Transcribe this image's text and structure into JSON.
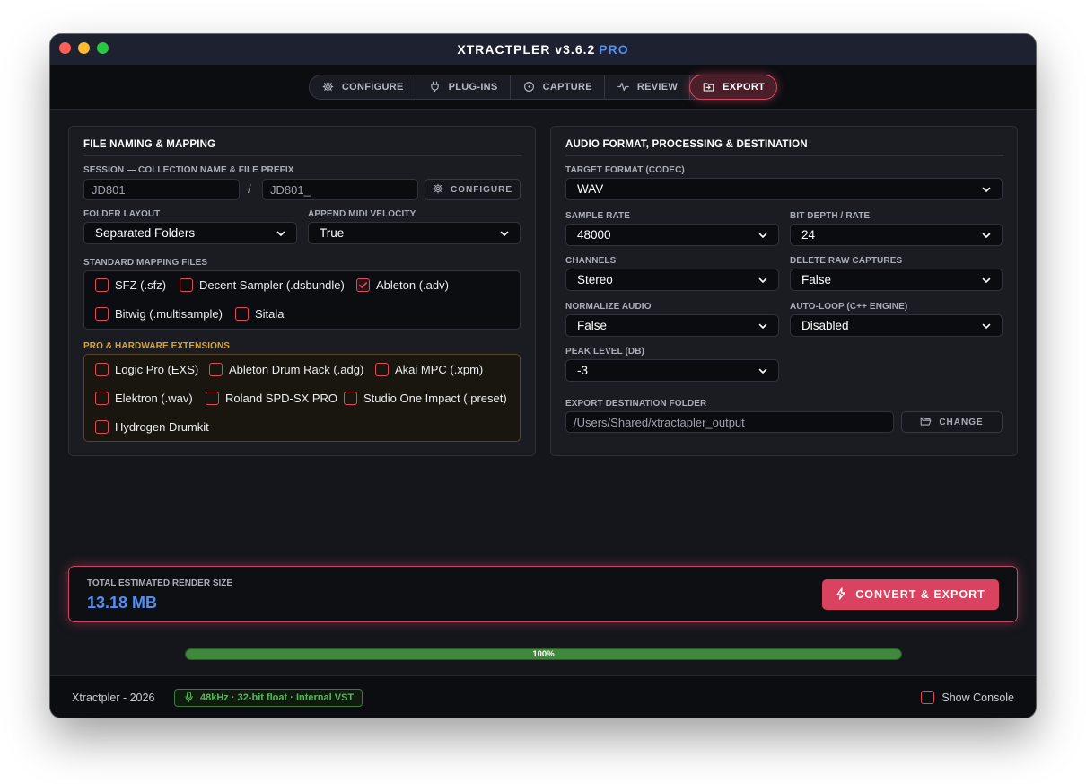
{
  "window": {
    "title": "XTRACTPLER v3.6.2",
    "badge": "PRO"
  },
  "tabs": [
    {
      "label": "CONFIGURE",
      "icon": "gear-icon"
    },
    {
      "label": "PLUG-INS",
      "icon": "plug-icon"
    },
    {
      "label": "CAPTURE",
      "icon": "record-icon"
    },
    {
      "label": "REVIEW",
      "icon": "waveform-icon"
    },
    {
      "label": "EXPORT",
      "icon": "export-folder-icon",
      "active": true
    }
  ],
  "left_panel": {
    "title": "FILE NAMING & MAPPING",
    "session_label": "SESSION — COLLECTION NAME & FILE PREFIX",
    "collection_name": "JD801",
    "separator": "/",
    "file_prefix": "JD801_",
    "configure_button": "CONFIGURE",
    "folder_layout_label": "FOLDER LAYOUT",
    "folder_layout_value": "Separated Folders",
    "append_velocity_label": "APPEND MIDI VELOCITY",
    "append_velocity_value": "True",
    "standard_label": "STANDARD MAPPING FILES",
    "standard_files": [
      {
        "label": "SFZ (.sfz)",
        "checked": false
      },
      {
        "label": "Decent Sampler (.dsbundle)",
        "checked": false
      },
      {
        "label": "Ableton (.adv)",
        "checked": true
      },
      {
        "label": "Bitwig (.multisample)",
        "checked": false
      },
      {
        "label": "Sitala",
        "checked": false
      }
    ],
    "pro_label": "PRO & HARDWARE EXTENSIONS",
    "pro_files": [
      {
        "label": "Logic Pro (EXS)",
        "checked": false
      },
      {
        "label": "Ableton Drum Rack (.adg)",
        "checked": false
      },
      {
        "label": "Akai MPC (.xpm)",
        "checked": false
      },
      {
        "label": "Elektron (.wav)",
        "checked": false
      },
      {
        "label": "Roland SPD-SX PRO",
        "checked": false
      },
      {
        "label": "Studio One Impact (.preset)",
        "checked": false
      },
      {
        "label": "Hydrogen Drumkit",
        "checked": false
      }
    ]
  },
  "right_panel": {
    "title": "AUDIO FORMAT, PROCESSING & DESTINATION",
    "target_format_label": "TARGET FORMAT (CODEC)",
    "target_format_value": "WAV",
    "sample_rate_label": "SAMPLE RATE",
    "sample_rate_value": "48000",
    "bit_depth_label": "BIT DEPTH / RATE",
    "bit_depth_value": "24",
    "channels_label": "CHANNELS",
    "channels_value": "Stereo",
    "delete_raw_label": "DELETE RAW CAPTURES",
    "delete_raw_value": "False",
    "normalize_label": "NORMALIZE AUDIO",
    "normalize_value": "False",
    "autoloop_label": "AUTO-LOOP (C++ ENGINE)",
    "autoloop_value": "Disabled",
    "peak_label": "PEAK LEVEL (DB)",
    "peak_value": "-3",
    "destination_label": "EXPORT DESTINATION FOLDER",
    "destination_value": "/Users/Shared/xtractapler_output",
    "change_button": "CHANGE"
  },
  "summary": {
    "label": "TOTAL ESTIMATED RENDER SIZE",
    "value": "13.18 MB",
    "button": "CONVERT & EXPORT"
  },
  "progress": {
    "value": 1.0,
    "text": "100%"
  },
  "footer": {
    "app": "Xtractpler - 2026",
    "status": "48kHz · 32-bit float · Internal VST",
    "console_label": "Show Console"
  },
  "colors": {
    "accent": "#d9435f",
    "value_blue": "#4f8ff7",
    "pro_gold": "#d9a43a",
    "ok_green": "#58b65a"
  }
}
